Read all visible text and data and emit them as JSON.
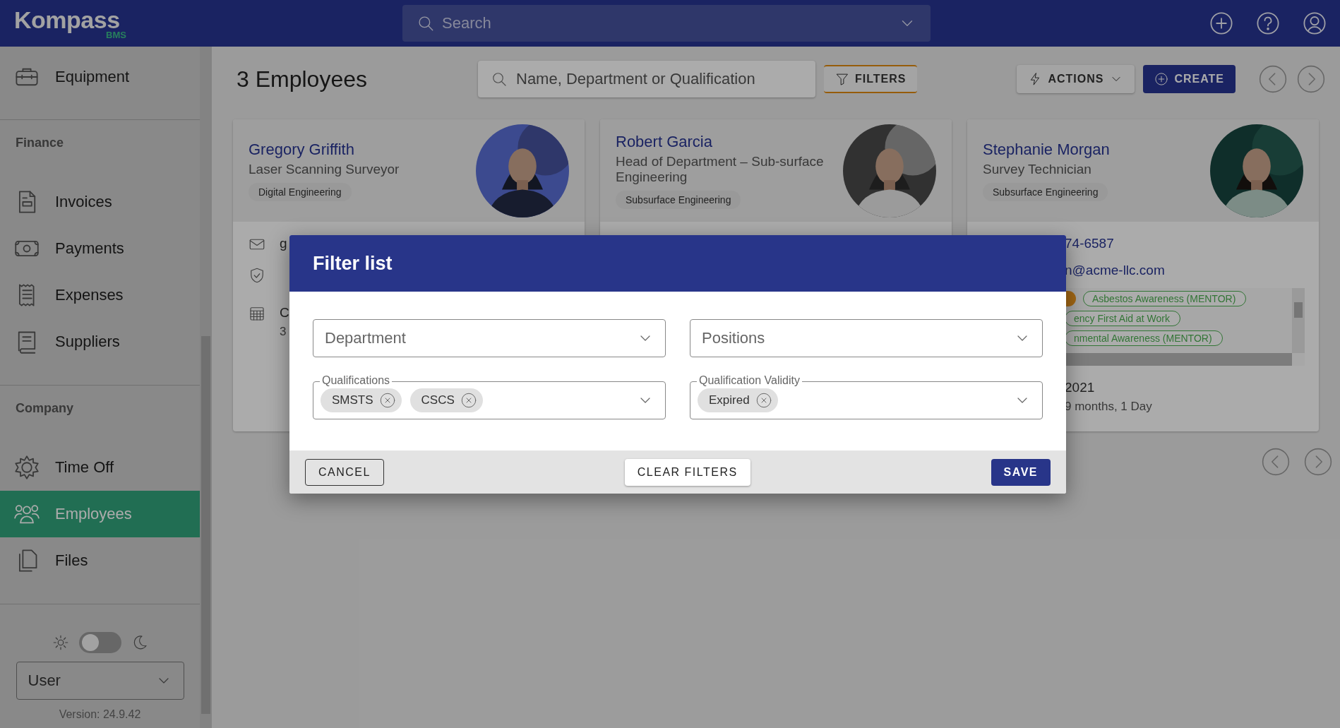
{
  "topbar": {
    "logo": "Kompass",
    "logo_sub": "BMS",
    "search": {
      "placeholder": "Search"
    }
  },
  "sidebar": {
    "sections": [
      {
        "items": [
          {
            "label": "Equipment",
            "selected": false
          }
        ]
      },
      {
        "title": "Finance",
        "items": [
          {
            "label": "Invoices",
            "selected": false
          },
          {
            "label": "Payments",
            "selected": false
          },
          {
            "label": "Expenses",
            "selected": false
          },
          {
            "label": "Suppliers",
            "selected": false
          }
        ]
      },
      {
        "title": "Company",
        "items": [
          {
            "label": "Time Off",
            "selected": false
          },
          {
            "label": "Employees",
            "selected": true
          },
          {
            "label": "Files",
            "selected": false
          }
        ]
      }
    ],
    "theme_toggle": {
      "on": false
    },
    "role_select": {
      "value": "User"
    },
    "version": "Version: 24.9.42"
  },
  "page": {
    "title": "3 Employees",
    "search": {
      "placeholder": "Name, Department or Qualification"
    },
    "filters_button": "FILTERS",
    "actions_button": "ACTIONS",
    "create_button": "CREATE"
  },
  "employees": [
    {
      "name": "Gregory Griffith",
      "position": "Laser Scanning Surveyor",
      "department": "Digital Engineering",
      "details": [
        {
          "kind": "email",
          "lines": [
            "g"
          ]
        },
        {
          "kind": "qualifications"
        },
        {
          "kind": "date",
          "lines": [
            "C",
            "3"
          ]
        }
      ]
    },
    {
      "name": "Robert Garcia",
      "position": "Head of Department – Sub-surface Engineering",
      "department": "Subsurface Engineering"
    },
    {
      "name": "Stephanie Morgan",
      "position": "Survey Technician",
      "department": "Subsurface Engineering",
      "details": [
        {
          "kind": "link",
          "lines": [
            "74-6587"
          ]
        },
        {
          "kind": "link",
          "lines": [
            "n@acme-llc.com"
          ]
        },
        {
          "kind": "tags",
          "qualification_rows": [
            [
              {
                "color": "#a26715"
              },
              {
                "text": "Asbestos Awareness (MENTOR)",
                "color": "#337536"
              }
            ],
            [
              {
                "text": "ency First Aid at Work",
                "color": "#337536"
              }
            ],
            [
              {
                "text": "nmental Awareness (MENTOR)",
                "color": "#337536"
              }
            ]
          ]
        },
        {
          "kind": "text",
          "lines": [
            "2021",
            "9 months, 1 Day"
          ]
        }
      ]
    }
  ],
  "dialog": {
    "title": "Filter list",
    "fields": [
      {
        "kind": "select",
        "placeholder": "Department"
      },
      {
        "kind": "select",
        "placeholder": "Positions"
      },
      {
        "kind": "chips",
        "label": "Qualifications",
        "chips": [
          "SMSTS",
          "CSCS"
        ]
      },
      {
        "kind": "chips",
        "label": "Qualification Validity",
        "chips": [
          "Expired"
        ]
      }
    ],
    "buttons": [
      {
        "label": "CANCEL",
        "kind": "outlined"
      },
      {
        "label": "CLEAR FILTERS",
        "kind": "raised"
      },
      {
        "label": "SAVE",
        "kind": "primary"
      }
    ]
  }
}
